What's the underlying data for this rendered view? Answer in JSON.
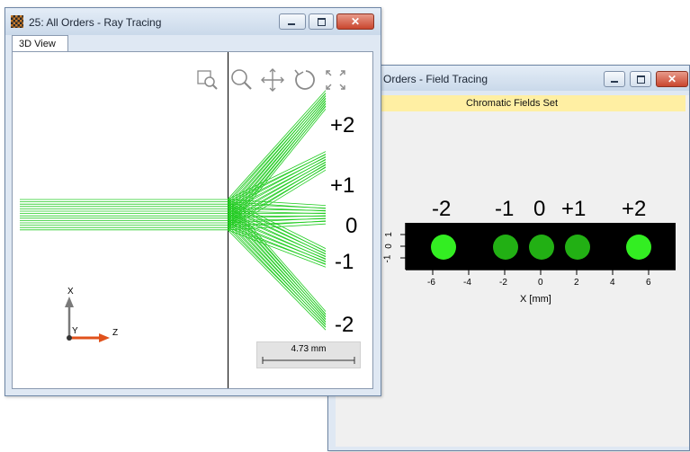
{
  "ray_window": {
    "title": "25: All Orders - Ray Tracing",
    "tab_label": "3D View",
    "order_labels": [
      "+2",
      "+1",
      "0",
      "-1",
      "-2"
    ],
    "axis_x_label": "X",
    "axis_y_label": "Y",
    "axis_z_label": "Z",
    "scale_bar_label": "4.73 mm",
    "toolbar_icons": [
      "zoom-window-icon",
      "magnifier-icon",
      "pan-icon",
      "rotate-icon",
      "fit-all-icon"
    ]
  },
  "field_window": {
    "title": "l Orders - Field Tracing",
    "banner": "Chromatic Fields Set",
    "order_labels": [
      "-2",
      "-1",
      "0",
      "+1",
      "+2"
    ],
    "x_ticks": [
      "-6",
      "-4",
      "-2",
      "0",
      "2",
      "4",
      "6"
    ],
    "y_ticks": [
      "-1",
      "0",
      "1"
    ],
    "x_axis_label": "X [mm]"
  },
  "colors": {
    "ray_green": "#22cc22",
    "spot_bright": "#33ee22",
    "spot_dim": "#22b014",
    "axis_orange": "#e0521c",
    "axis_gray": "#7a7a7a"
  }
}
